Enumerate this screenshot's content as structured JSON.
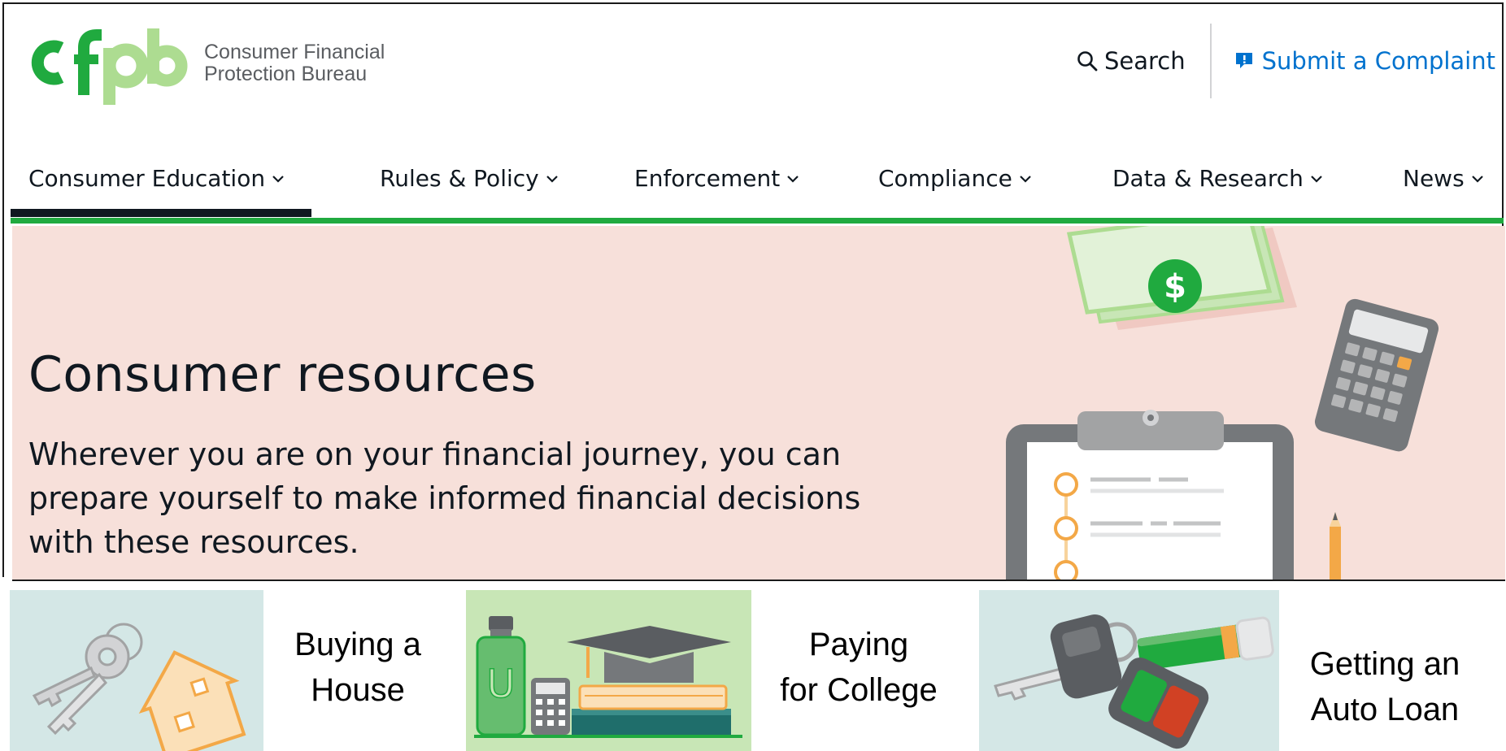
{
  "header": {
    "logo_text_line1": "Consumer Financial",
    "logo_text_line2": "Protection Bureau",
    "search_label": "Search",
    "complaint_label": "Submit a Complaint",
    "colors": {
      "brand_green": "#20aa3f",
      "light_green": "#addc91",
      "link_blue": "#0072ce"
    }
  },
  "nav": {
    "items": [
      {
        "label": "Consumer Education"
      },
      {
        "label": "Rules & Policy"
      },
      {
        "label": "Enforcement"
      },
      {
        "label": "Compliance"
      },
      {
        "label": "Data & Research"
      },
      {
        "label": "News"
      }
    ],
    "active_index": 0
  },
  "hero": {
    "title": "Consumer resources",
    "description": "Wherever you are on your financial journey, you can prepare yourself to make informed financial decisions with these resources.",
    "dollar_sign": "$",
    "background": "#f7e0da"
  },
  "cards": [
    {
      "label_line1": "Buying a",
      "label_line2": "House",
      "icon": "house-keys-icon"
    },
    {
      "label_line1": "Paying",
      "label_line2": "for College",
      "icon": "graduation-cap-icon"
    },
    {
      "label_line1": "Getting an",
      "label_line2": "Auto Loan",
      "icon": "car-keys-icon"
    }
  ]
}
